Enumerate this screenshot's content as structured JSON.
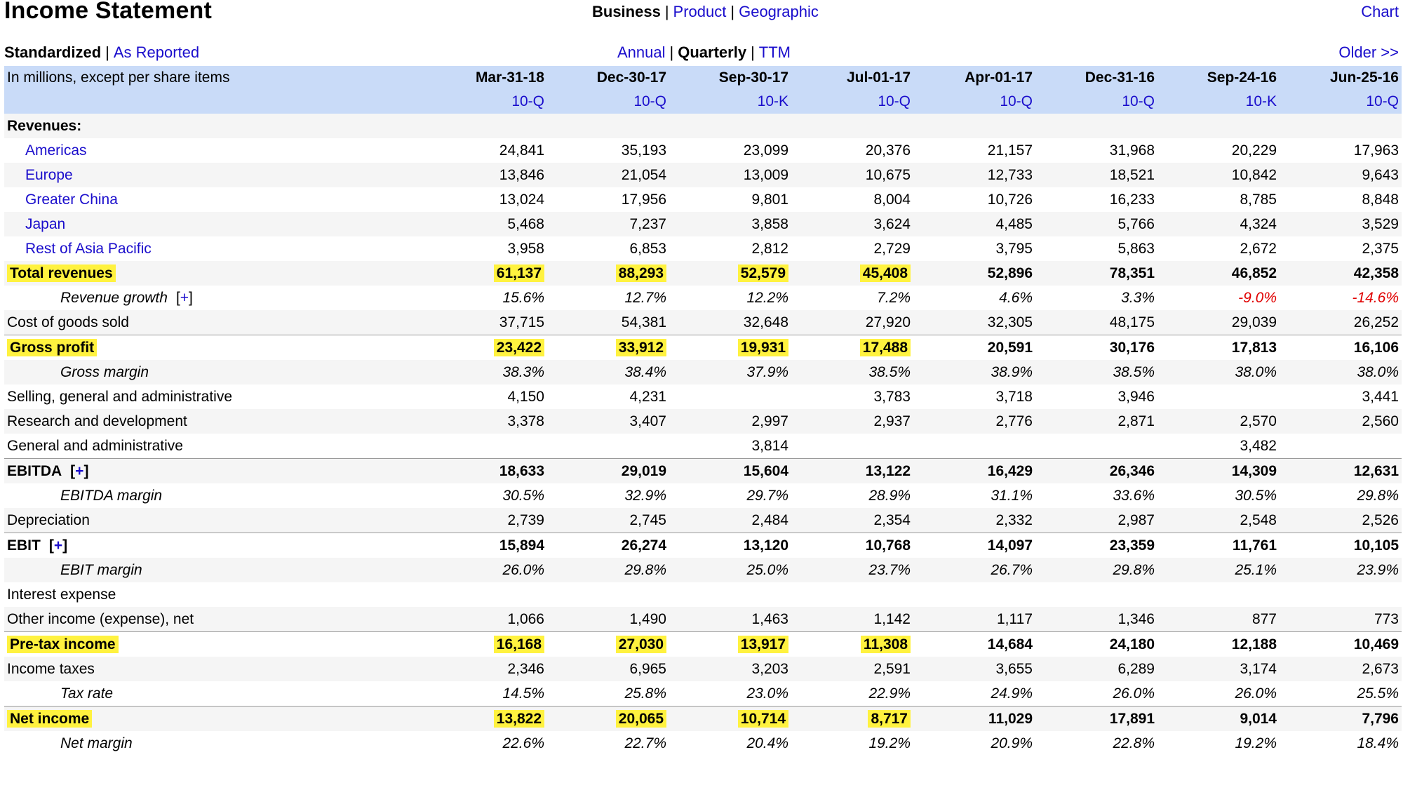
{
  "page_title": "Income Statement",
  "top_nav": {
    "business": "Business",
    "product": "Product",
    "geographic": "Geographic",
    "chart": "Chart"
  },
  "view_nav": {
    "standardized": "Standardized",
    "as_reported": "As Reported"
  },
  "period_nav": {
    "annual": "Annual",
    "quarterly": "Quarterly",
    "ttm": "TTM",
    "older": "Older >>"
  },
  "table": {
    "units_label": "In millions, except per share items",
    "columns": [
      {
        "date": "Mar-31-18",
        "form": "10-Q"
      },
      {
        "date": "Dec-30-17",
        "form": "10-Q"
      },
      {
        "date": "Sep-30-17",
        "form": "10-K"
      },
      {
        "date": "Jul-01-17",
        "form": "10-Q"
      },
      {
        "date": "Apr-01-17",
        "form": "10-Q"
      },
      {
        "date": "Dec-31-16",
        "form": "10-Q"
      },
      {
        "date": "Sep-24-16",
        "form": "10-K"
      },
      {
        "date": "Jun-25-16",
        "form": "10-Q"
      }
    ],
    "rows": [
      {
        "label": "Revenues:",
        "style": "section",
        "values": [
          "",
          "",
          "",
          "",
          "",
          "",
          "",
          ""
        ]
      },
      {
        "label": "Americas",
        "style": "link",
        "values": [
          "24,841",
          "35,193",
          "23,099",
          "20,376",
          "21,157",
          "31,968",
          "20,229",
          "17,963"
        ]
      },
      {
        "label": "Europe",
        "style": "link",
        "values": [
          "13,846",
          "21,054",
          "13,009",
          "10,675",
          "12,733",
          "18,521",
          "10,842",
          "9,643"
        ]
      },
      {
        "label": "Greater China",
        "style": "link",
        "values": [
          "13,024",
          "17,956",
          "9,801",
          "8,004",
          "10,726",
          "16,233",
          "8,785",
          "8,848"
        ]
      },
      {
        "label": "Japan",
        "style": "link",
        "values": [
          "5,468",
          "7,237",
          "3,858",
          "3,624",
          "4,485",
          "5,766",
          "4,324",
          "3,529"
        ]
      },
      {
        "label": "Rest of Asia Pacific",
        "style": "link",
        "values": [
          "3,958",
          "6,853",
          "2,812",
          "2,729",
          "3,795",
          "5,863",
          "2,672",
          "2,375"
        ]
      },
      {
        "label": "Total revenues",
        "style": "total",
        "values": [
          "61,137",
          "88,293",
          "52,579",
          "45,408",
          "52,896",
          "78,351",
          "46,852",
          "42,358"
        ]
      },
      {
        "label": "Revenue growth",
        "style": "pct",
        "plus": "+",
        "values": [
          "15.6%",
          "12.7%",
          "12.2%",
          "7.2%",
          "4.6%",
          "3.3%",
          "-9.0%",
          "-14.6%"
        ]
      },
      {
        "label": "Cost of goods sold",
        "style": "normal",
        "values": [
          "37,715",
          "54,381",
          "32,648",
          "27,920",
          "32,305",
          "48,175",
          "29,039",
          "26,252"
        ]
      },
      {
        "label": "Gross profit",
        "style": "total",
        "topline": true,
        "values": [
          "23,422",
          "33,912",
          "19,931",
          "17,488",
          "20,591",
          "30,176",
          "17,813",
          "16,106"
        ]
      },
      {
        "label": "Gross margin",
        "style": "pct",
        "values": [
          "38.3%",
          "38.4%",
          "37.9%",
          "38.5%",
          "38.9%",
          "38.5%",
          "38.0%",
          "38.0%"
        ]
      },
      {
        "label": "Selling, general and administrative",
        "style": "normal",
        "values": [
          "4,150",
          "4,231",
          "",
          "3,783",
          "3,718",
          "3,946",
          "",
          "3,441"
        ]
      },
      {
        "label": "Research and development",
        "style": "normal",
        "values": [
          "3,378",
          "3,407",
          "2,997",
          "2,937",
          "2,776",
          "2,871",
          "2,570",
          "2,560"
        ]
      },
      {
        "label": "General and administrative",
        "style": "normal",
        "values": [
          "",
          "",
          "3,814",
          "",
          "",
          "",
          "3,482",
          ""
        ]
      },
      {
        "label": "EBITDA",
        "style": "bold",
        "plus": "+",
        "topline": true,
        "values": [
          "18,633",
          "29,019",
          "15,604",
          "13,122",
          "16,429",
          "26,346",
          "14,309",
          "12,631"
        ]
      },
      {
        "label": "EBITDA margin",
        "style": "pct",
        "values": [
          "30.5%",
          "32.9%",
          "29.7%",
          "28.9%",
          "31.1%",
          "33.6%",
          "30.5%",
          "29.8%"
        ]
      },
      {
        "label": "Depreciation",
        "style": "normal",
        "values": [
          "2,739",
          "2,745",
          "2,484",
          "2,354",
          "2,332",
          "2,987",
          "2,548",
          "2,526"
        ]
      },
      {
        "label": "EBIT",
        "style": "bold",
        "plus": "+",
        "topline": true,
        "values": [
          "15,894",
          "26,274",
          "13,120",
          "10,768",
          "14,097",
          "23,359",
          "11,761",
          "10,105"
        ]
      },
      {
        "label": "EBIT margin",
        "style": "pct",
        "values": [
          "26.0%",
          "29.8%",
          "25.0%",
          "23.7%",
          "26.7%",
          "29.8%",
          "25.1%",
          "23.9%"
        ]
      },
      {
        "label": "Interest expense",
        "style": "normal",
        "values": [
          "",
          "",
          "",
          "",
          "",
          "",
          "",
          ""
        ]
      },
      {
        "label": "Other income (expense), net",
        "style": "normal",
        "values": [
          "1,066",
          "1,490",
          "1,463",
          "1,142",
          "1,117",
          "1,346",
          "877",
          "773"
        ]
      },
      {
        "label": "Pre-tax income",
        "style": "total",
        "topline": true,
        "values": [
          "16,168",
          "27,030",
          "13,917",
          "11,308",
          "14,684",
          "24,180",
          "12,188",
          "10,469"
        ]
      },
      {
        "label": "Income taxes",
        "style": "normal",
        "values": [
          "2,346",
          "6,965",
          "3,203",
          "2,591",
          "3,655",
          "6,289",
          "3,174",
          "2,673"
        ]
      },
      {
        "label": "Tax rate",
        "style": "pct",
        "values": [
          "14.5%",
          "25.8%",
          "23.0%",
          "22.9%",
          "24.9%",
          "26.0%",
          "26.0%",
          "25.5%"
        ]
      },
      {
        "label": "Net income",
        "style": "total",
        "topline": true,
        "values": [
          "13,822",
          "20,065",
          "10,714",
          "8,717",
          "11,029",
          "17,891",
          "9,014",
          "7,796"
        ]
      },
      {
        "label": "Net margin",
        "style": "pct",
        "values": [
          "22.6%",
          "22.7%",
          "20.4%",
          "19.2%",
          "20.9%",
          "22.8%",
          "19.2%",
          "18.4%"
        ]
      }
    ]
  },
  "colors": {
    "link": "#1a0dcc",
    "highlight": "#fff23f",
    "header_bg": "#c9dbf8",
    "negative": "#e00000"
  },
  "highlighted_columns": 4
}
